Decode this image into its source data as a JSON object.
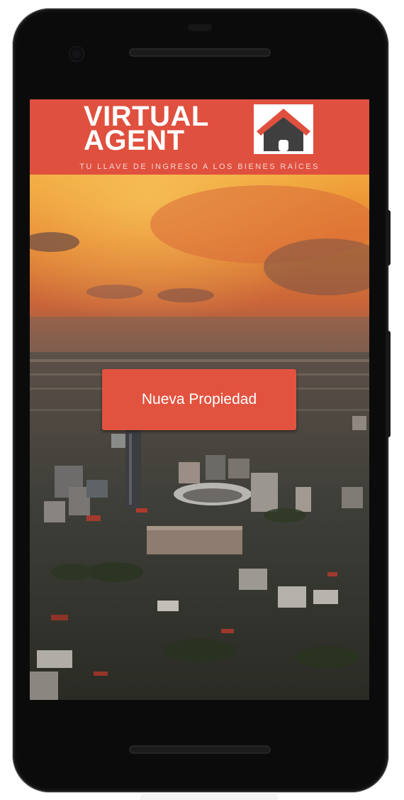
{
  "app": {
    "logo_line1": "VIRTUAL",
    "logo_line2": "AGENT",
    "tagline": "TU LLAVE DE INGRESO A LOS BIENES RAÍCES",
    "logo_icon": "house-icon"
  },
  "main": {
    "new_property_label": "Nueva Propiedad"
  },
  "colors": {
    "brand_red": "#e0503f",
    "button_red": "#e2533f",
    "logo_house_gray": "#3f3f40"
  }
}
